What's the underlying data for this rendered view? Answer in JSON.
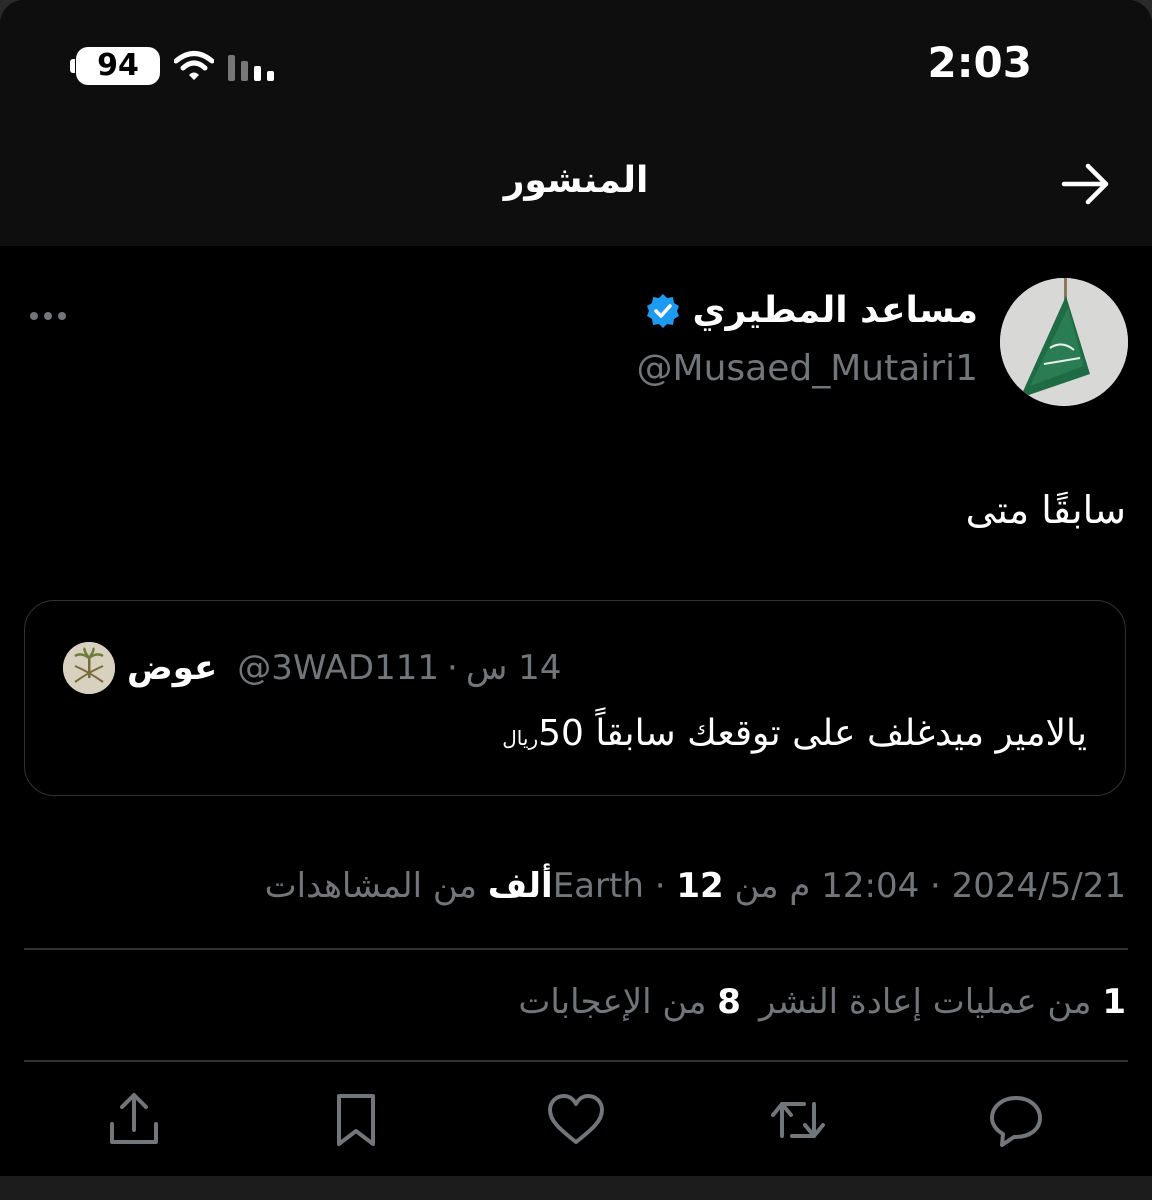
{
  "status_bar": {
    "time": "2:03",
    "battery": "94"
  },
  "header": {
    "title": "المنشور"
  },
  "post": {
    "author_name": "مساعد المطيري",
    "author_handle": "@Musaed_Mutairi1",
    "text": "سابقًا متى",
    "verified": true
  },
  "quote": {
    "author_name": "عوض",
    "author_handle": "@3WAD111",
    "separator": "·",
    "time": "14 س",
    "text": "يالامير ميدغلف على توقعك سابقاً 50",
    "currency": "ريال"
  },
  "meta": {
    "date": "2024/5/21",
    "time": "12:04 م",
    "source": "من Earth",
    "views_count": "12ألف",
    "views_label": "من المشاهدات",
    "separator": "·"
  },
  "stats": {
    "reposts_count": "1",
    "reposts_label": "من عمليات إعادة النشر",
    "likes_count": "8",
    "likes_label": "من الإعجابات"
  },
  "colors": {
    "background": "#000000",
    "text_primary": "#e7e9ea",
    "text_secondary": "#71767b",
    "border": "#2f3336",
    "verified": "#1d9bf0"
  }
}
